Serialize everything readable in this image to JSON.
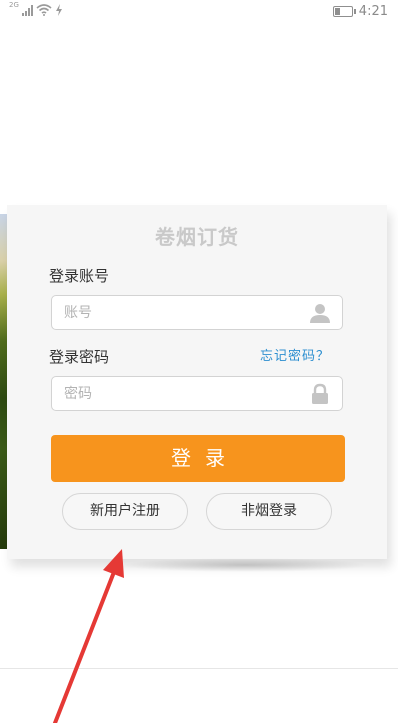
{
  "status_bar": {
    "network": "2G",
    "time": "4:21",
    "battery_level": 0.35
  },
  "login": {
    "title": "卷烟订货",
    "account_label": "登录账号",
    "account_placeholder": "账号",
    "password_label": "登录密码",
    "forgot_password": "忘记密码？",
    "password_placeholder": "密码",
    "login_button": "登录",
    "register_button": "新用户注册",
    "non_tobacco_login_button": "非烟登录"
  },
  "icons": {
    "account": "user-icon",
    "password": "lock-icon",
    "signal": "signal-icon",
    "wifi": "wifi-icon",
    "charging": "lightning-icon",
    "battery": "battery-icon"
  },
  "colors": {
    "accent": "#f7941d",
    "link": "#2d8fd0",
    "annotation_arrow": "#e53935"
  }
}
